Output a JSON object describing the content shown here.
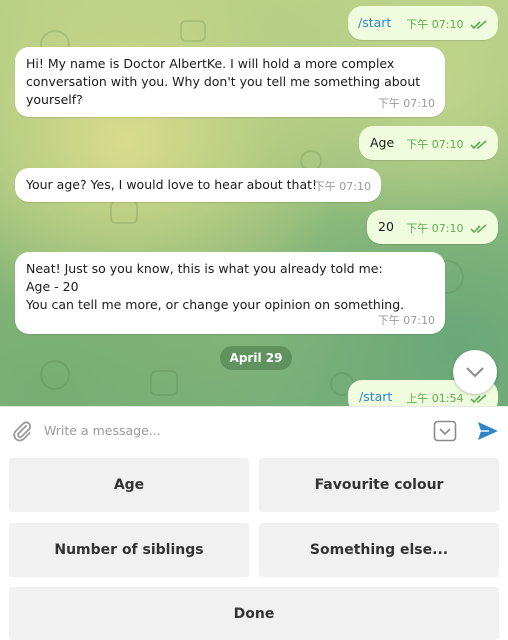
{
  "messages": [
    {
      "text": "/start",
      "time": "下午 07:10"
    },
    {
      "text": "Hi! My name is Doctor AlbertKe. I will hold a more complex conversation with you. Why don't you tell me something about yourself?",
      "time": "下午 07:10"
    },
    {
      "text": "Age",
      "time": "下午 07:10"
    },
    {
      "text": "Your age? Yes, I would love to hear about that!",
      "time": "下午 07:10"
    },
    {
      "text": "20",
      "time": "下午 07:10"
    },
    {
      "lines": [
        "Neat! Just so you know, this is what you already told me:",
        "Age - 20",
        "You can tell me more, or change your opinion on something."
      ],
      "time": "下午 07:10"
    },
    {
      "text": "/start",
      "time": "上午 01:54"
    }
  ],
  "date_separator": "April 29",
  "composer": {
    "placeholder": "Write a message..."
  },
  "keyboard": {
    "age": "Age",
    "favourite_colour": "Favourite colour",
    "siblings": "Number of siblings",
    "something_else": "Something else...",
    "done": "Done"
  },
  "colors": {
    "incoming": "#ffffff",
    "outgoing": "#effdde",
    "accent": "#2f86c9",
    "tick": "#5fac52"
  },
  "icons": [
    "paperclip-icon",
    "keyboard-toggle-icon",
    "send-icon",
    "scroll-down-icon",
    "double-check-icon"
  ]
}
